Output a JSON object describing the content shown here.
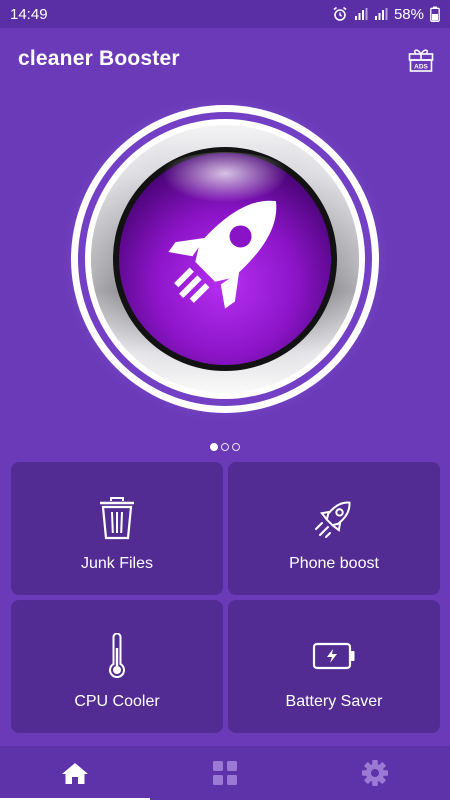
{
  "status_bar": {
    "time": "14:49",
    "battery_percent": "58%",
    "icons": [
      "image-icon",
      "alarm-icon",
      "signal-icon",
      "signal-icon",
      "battery-icon"
    ]
  },
  "header": {
    "title": "cleaner Booster",
    "gift_icon": "gift-ads-icon",
    "gift_label": "ADS"
  },
  "hero": {
    "icon": "rocket-icon"
  },
  "pager": {
    "total": 3,
    "active_index": 0
  },
  "features": [
    {
      "label": "Junk Files",
      "icon": "trash-icon"
    },
    {
      "label": "Phone boost",
      "icon": "rocket-outline-icon"
    },
    {
      "label": "CPU Cooler",
      "icon": "thermometer-icon"
    },
    {
      "label": "Battery Saver",
      "icon": "battery-charging-icon"
    }
  ],
  "bottom_nav": [
    {
      "icon": "home-icon",
      "active": true
    },
    {
      "icon": "grid-icon",
      "active": false
    },
    {
      "icon": "gear-icon",
      "active": false
    }
  ],
  "colors": {
    "background": "#6a3ab8",
    "tile": "#532c93",
    "accent": "#a21fe0"
  }
}
